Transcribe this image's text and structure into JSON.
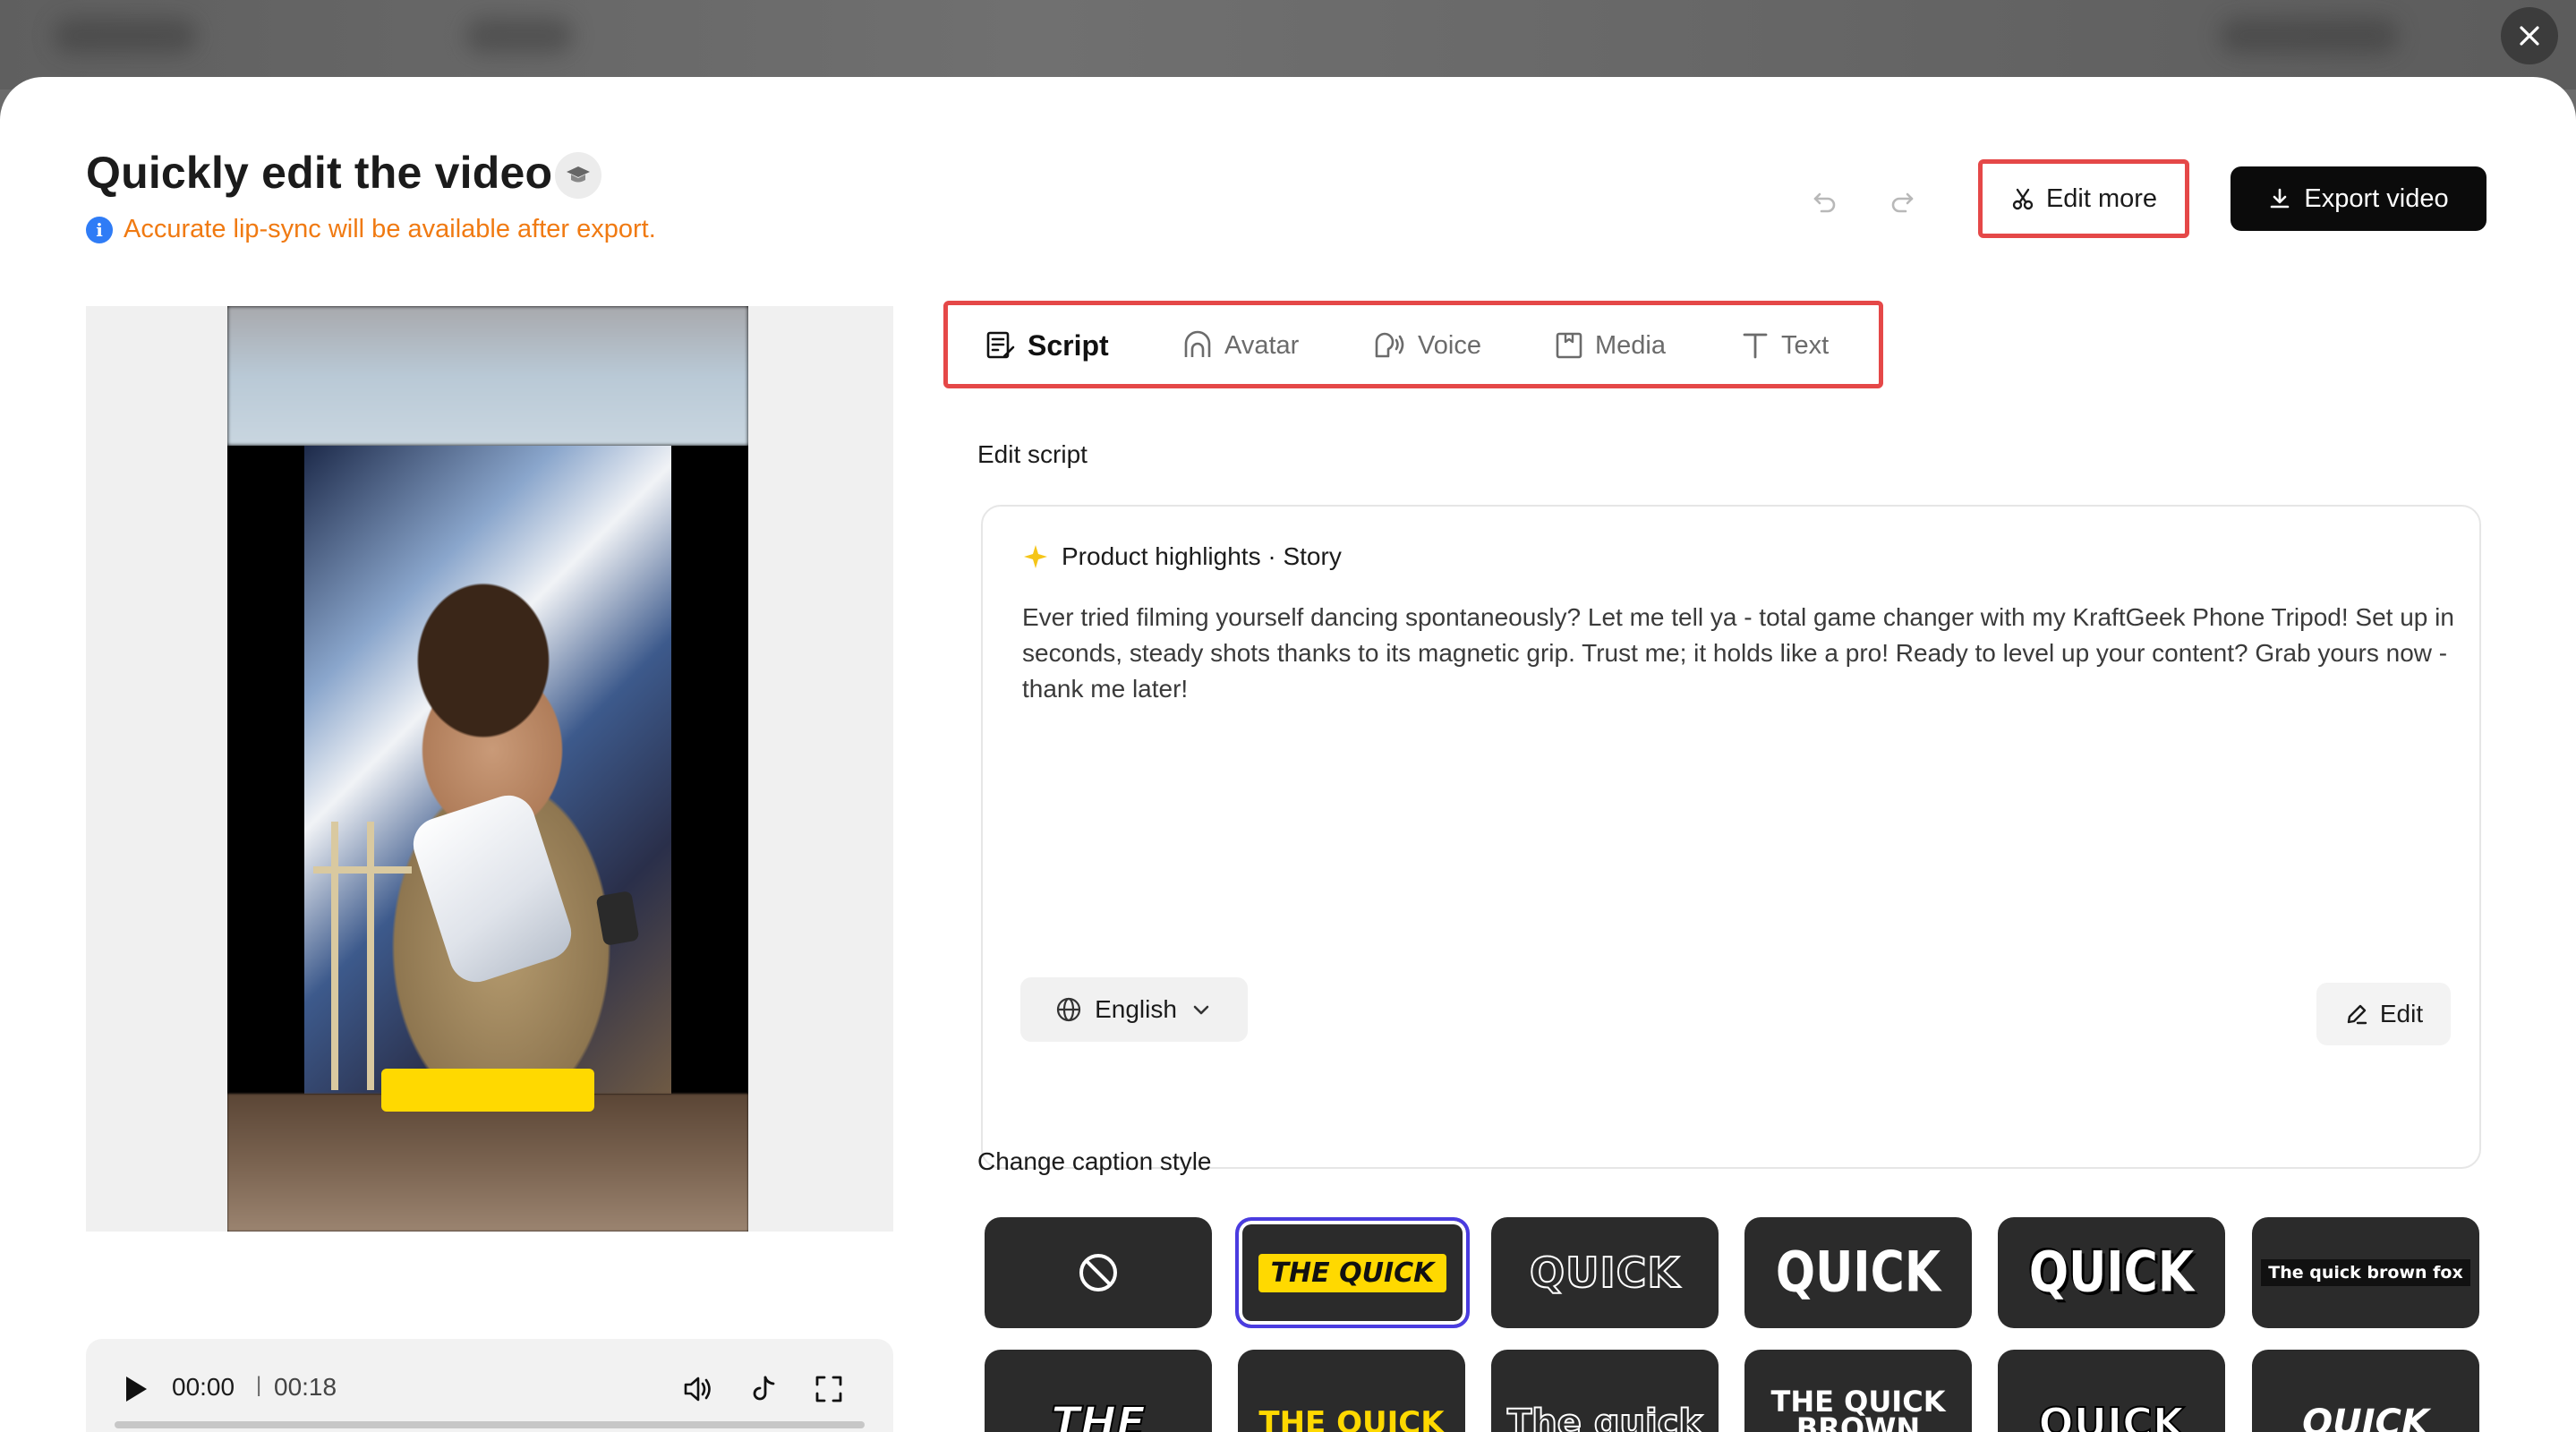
{
  "header": {
    "title": "Quickly edit the video",
    "notice": "Accurate lip-sync will be available after export."
  },
  "actions": {
    "edit_more": "Edit more",
    "export": "Export video"
  },
  "player": {
    "current_time": "00:00",
    "separator": "|",
    "total_time": "00:18",
    "progress": 0
  },
  "tabs": [
    {
      "label": "Script",
      "icon": "script-icon",
      "active": true
    },
    {
      "label": "Avatar",
      "icon": "avatar-icon",
      "active": false
    },
    {
      "label": "Voice",
      "icon": "voice-icon",
      "active": false
    },
    {
      "label": "Media",
      "icon": "media-icon",
      "active": false
    },
    {
      "label": "Text",
      "icon": "text-icon",
      "active": false
    }
  ],
  "script": {
    "section_label": "Edit script",
    "header": "Product highlights · Story",
    "body": "Ever tried filming yourself dancing spontaneously? Let me tell ya - total game changer with my KraftGeek Phone Tripod! Set up in seconds, steady shots thanks to its magnetic grip. Trust me; it holds like a pro! Ready to level up your content? Grab yours now - thank me later!",
    "language": "English",
    "edit_label": "Edit"
  },
  "captions": {
    "section_label": "Change caption style",
    "styles": [
      {
        "text": "",
        "icon": "no-caption-icon",
        "selected": false
      },
      {
        "text": "THE QUICK",
        "selected": true
      },
      {
        "text": "QUICK",
        "selected": false
      },
      {
        "text": "QUICK",
        "selected": false
      },
      {
        "text": "QUICK",
        "selected": false
      },
      {
        "text": "The quick brown fox",
        "selected": false
      },
      {
        "text": "THE",
        "selected": false
      },
      {
        "text": "THE QUICK",
        "selected": false
      },
      {
        "text": "The quick",
        "selected": false
      },
      {
        "text": "THE QUICK BROWN FOX",
        "selected": false
      },
      {
        "text": "QUICK",
        "selected": false
      },
      {
        "text": "QUICK",
        "selected": false
      }
    ]
  },
  "colors": {
    "accent_highlight": "#e54848",
    "notice": "#f07a12",
    "selected_style": "#4a3ce0",
    "caption_yellow": "#ffd900"
  }
}
